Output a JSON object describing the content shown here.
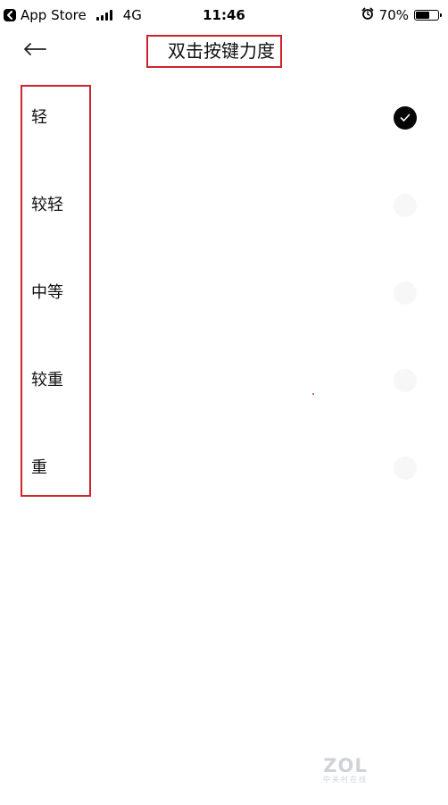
{
  "status_bar": {
    "back_app_label": "App Store",
    "network": "4G",
    "time": "11:46",
    "battery_percent": "70%",
    "battery_level": 0.7
  },
  "header": {
    "title": "双击按键力度",
    "title_highlight_color": "#d0242c"
  },
  "options": [
    {
      "label": "轻",
      "selected": true
    },
    {
      "label": "较轻",
      "selected": false
    },
    {
      "label": "中等",
      "selected": false
    },
    {
      "label": "较重",
      "selected": false
    },
    {
      "label": "重",
      "selected": false
    }
  ],
  "watermark": {
    "main": "ZOL",
    "sub": "中关村在线"
  },
  "colors": {
    "highlight_border": "#d0242c",
    "selected_radio": "#050505",
    "unselected_radio": "#f7f7f7"
  },
  "icons": {
    "back_app": "chevron-left-icon",
    "signal": "signal-bars-icon",
    "alarm": "alarm-clock-icon",
    "battery": "battery-icon",
    "back": "arrow-left-icon",
    "check": "checkmark-icon"
  }
}
